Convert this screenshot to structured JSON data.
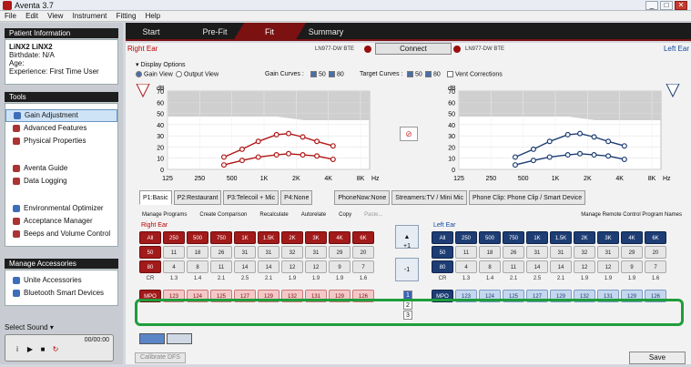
{
  "window": {
    "title": "Aventa 3.7",
    "buttons": [
      "_",
      "□",
      "✕"
    ]
  },
  "menu": [
    "File",
    "Edit",
    "View",
    "Instrument",
    "Fitting",
    "Help"
  ],
  "nav": {
    "tabs": [
      "Start",
      "Pre-Fit",
      "Fit",
      "Summary"
    ],
    "active": 2
  },
  "sidebar": {
    "patient": {
      "heading": "Patient Information",
      "name": "LiNX2 LiNX2",
      "birthdate": "Birthdate: N/A",
      "age": "Age:",
      "experience": "Experience: First Time User"
    },
    "tools": {
      "heading": "Tools",
      "items": [
        {
          "label": "Gain Adjustment",
          "selected": true,
          "color": "#3d6fb8"
        },
        {
          "label": "Advanced Features",
          "color": "#a33"
        },
        {
          "label": "Physical Properties",
          "color": "#a33"
        },
        {
          "label": "Aventa Guide",
          "color": "#a33"
        },
        {
          "label": "Data Logging",
          "color": "#a33"
        },
        {
          "label": "Environmental Optimizer",
          "color": "#3d6fb8"
        },
        {
          "label": "Acceptance Manager",
          "color": "#a33"
        },
        {
          "label": "Beeps and Volume Control",
          "color": "#a33"
        }
      ]
    },
    "accessories": {
      "heading": "Manage Accessories",
      "items": [
        {
          "label": "Unite Accessories",
          "color": "#3d6fb8"
        },
        {
          "label": "Bluetooth Smart Devices",
          "color": "#3d6fb8"
        }
      ]
    },
    "select_sound": {
      "label": "Select Sound",
      "time": "00/00:00",
      "controls": [
        "i",
        "▶",
        "■",
        "↻"
      ]
    }
  },
  "ear_bar": {
    "right": "Right Ear",
    "left": "Left Ear",
    "connect": "Connect",
    "device_r": "LN977-DW BTE",
    "device_l": "LN977-DW BTE"
  },
  "display_options": {
    "heading": "Display Options",
    "gain_view": "Gain View",
    "output_view": "Output View",
    "gain_curves": "Gain Curves :",
    "target_curves": "Target Curves :",
    "vent": "Vent Corrections",
    "levels": [
      "50",
      "80"
    ]
  },
  "graphs": {
    "yunit": "dB",
    "yticks": [
      "70",
      "60",
      "50",
      "40",
      "30",
      "20",
      "10",
      "0"
    ],
    "xticks": [
      "125",
      "250",
      "500",
      "1K",
      "2K",
      "4K",
      "8K"
    ],
    "xunit": "Hz",
    "right": {
      "color": "#b01616",
      "curve80": [
        11,
        18,
        25,
        31,
        32,
        29,
        25,
        21
      ],
      "curve50": [
        4,
        8,
        11,
        13,
        14,
        13,
        12,
        9
      ]
    },
    "left": {
      "color": "#1d3d74",
      "curve80": [
        11,
        18,
        25,
        31,
        32,
        29,
        25,
        21
      ],
      "curve50": [
        4,
        8,
        11,
        13,
        14,
        13,
        12,
        9
      ]
    }
  },
  "program_tabs": [
    "P1:Basic",
    "P2:Restaurant",
    "P3:Telecoil + Mic",
    "P4:None",
    "PhoneNow:None",
    "Streamers:TV / Mini Mic",
    "Phone Clip: Phone Clip / Smart Device"
  ],
  "tool_links": [
    "Manage Programs",
    "Create Comparison",
    "Recalculate",
    "Autorelate",
    "Copy",
    "Paste..."
  ],
  "remote_link": "Manage Remote Control Program Names",
  "right_ear": {
    "heading": "Right Ear",
    "header": [
      "All",
      "250",
      "500",
      "750",
      "1K",
      "1.5K",
      "2K",
      "3K",
      "4K",
      "6K"
    ],
    "row50": [
      "50",
      "11",
      "18",
      "26",
      "31",
      "31",
      "32",
      "31",
      "29",
      "20"
    ],
    "row80": [
      "80",
      "4",
      "8",
      "11",
      "14",
      "14",
      "12",
      "12",
      "9",
      "7"
    ],
    "cr": [
      "CR",
      "1.3",
      "1.4",
      "2.1",
      "2.5",
      "2.1",
      "1.9",
      "1.9",
      "1.9",
      "1.6"
    ],
    "mpo": [
      "MPO",
      "123",
      "124",
      "125",
      "127",
      "129",
      "132",
      "131",
      "129",
      "126"
    ]
  },
  "left_ear": {
    "heading": "Left Ear",
    "header": [
      "All",
      "250",
      "500",
      "750",
      "1K",
      "1.5K",
      "2K",
      "3K",
      "4K",
      "6K"
    ],
    "row50": [
      "50",
      "11",
      "18",
      "26",
      "31",
      "31",
      "32",
      "31",
      "29",
      "20"
    ],
    "row80": [
      "80",
      "4",
      "8",
      "11",
      "14",
      "14",
      "12",
      "12",
      "9",
      "7"
    ],
    "cr": [
      "CR",
      "1.3",
      "1.4",
      "2.1",
      "2.5",
      "2.1",
      "1.9",
      "1.9",
      "1.9",
      "1.6"
    ],
    "mpo": [
      "MPO",
      "123",
      "124",
      "125",
      "127",
      "129",
      "132",
      "131",
      "129",
      "126"
    ]
  },
  "mid": {
    "up": "+1",
    "down": "-1",
    "pages": [
      "1",
      "2",
      "3"
    ]
  },
  "buttons": {
    "calibrate": "Calibrate DFS",
    "save": "Save"
  }
}
